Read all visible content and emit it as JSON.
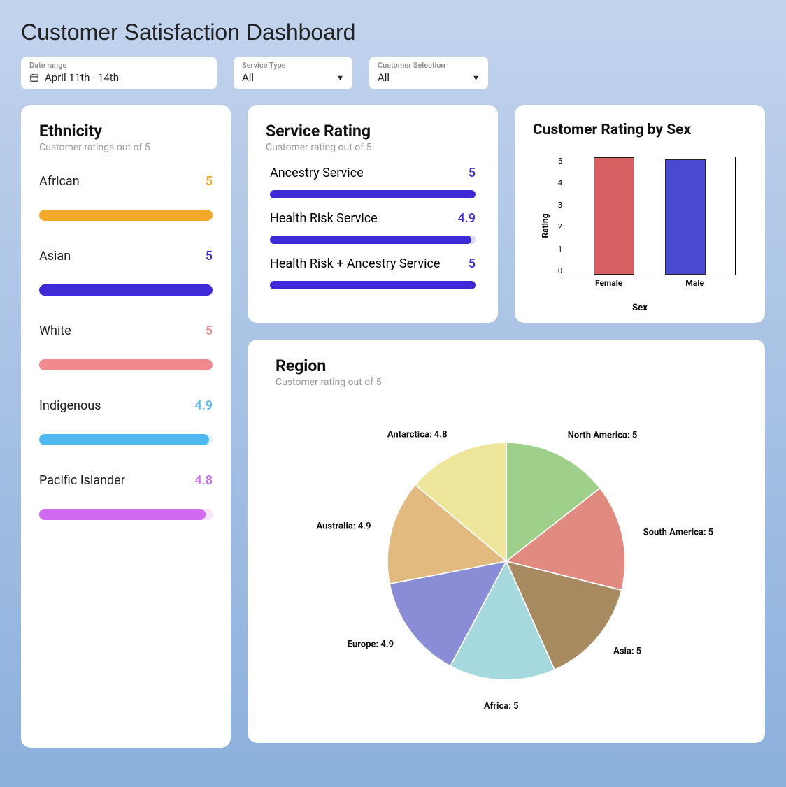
{
  "title": "Customer Satisfaction Dashboard",
  "filters": {
    "date_range": {
      "label": "Date range",
      "value": "April 11th - 14th"
    },
    "service_type": {
      "label": "Service Type",
      "value": "All"
    },
    "customer_selection": {
      "label": "Customer Selection",
      "value": "All"
    }
  },
  "ethnicity": {
    "title": "Ethnicity",
    "subtitle": "Customer ratings out of 5",
    "max": 5,
    "items": [
      {
        "name": "African",
        "value": 5,
        "color": "#f2a92b",
        "value_color": "#f2a92b"
      },
      {
        "name": "Asian",
        "value": 5,
        "color": "#3e2ad6",
        "value_color": "#3e2ad6"
      },
      {
        "name": "White",
        "value": 5,
        "color": "#f08a8f",
        "value_color": "#f08a8f"
      },
      {
        "name": "Indigenous",
        "value": 4.9,
        "color": "#4fb9ef",
        "value_color": "#4fb9ef"
      },
      {
        "name": "Pacific Islander",
        "value": 4.8,
        "color": "#d06af0",
        "value_color": "#d06af0"
      }
    ]
  },
  "service_rating": {
    "title": "Service Rating",
    "subtitle": "Customer rating out of 5",
    "max": 5,
    "items": [
      {
        "name": "Ancestry Service",
        "value": 5
      },
      {
        "name": "Health Risk Service",
        "value": 4.9
      },
      {
        "name": "Health Risk + Ancestry Service",
        "value": 5
      }
    ]
  },
  "sex_rating": {
    "title": "Customer Rating by Sex",
    "ylabel": "Rating",
    "xlabel": "Sex"
  },
  "region": {
    "title": "Region",
    "subtitle": "Customer rating out of 5"
  },
  "chart_data": [
    {
      "id": "ethnicity",
      "type": "bar",
      "title": "Ethnicity — Customer ratings out of 5",
      "categories": [
        "African",
        "Asian",
        "White",
        "Indigenous",
        "Pacific Islander"
      ],
      "values": [
        5,
        5,
        5,
        4.9,
        4.8
      ],
      "ylim": [
        0,
        5
      ]
    },
    {
      "id": "service_rating",
      "type": "bar",
      "title": "Service Rating — Customer rating out of 5",
      "categories": [
        "Ancestry Service",
        "Health Risk Service",
        "Health Risk + Ancestry Service"
      ],
      "values": [
        5,
        4.9,
        5
      ],
      "ylim": [
        0,
        5
      ]
    },
    {
      "id": "customer_rating_by_sex",
      "type": "bar",
      "title": "Customer Rating by Sex",
      "xlabel": "Sex",
      "ylabel": "Rating",
      "categories": [
        "Female",
        "Male"
      ],
      "values": [
        5,
        4.9
      ],
      "colors": [
        "#d66062",
        "#4a4ad1"
      ],
      "ylim": [
        0,
        5
      ],
      "yticks": [
        0,
        1,
        2,
        3,
        4,
        5
      ]
    },
    {
      "id": "region",
      "type": "pie",
      "title": "Region — Customer rating out of 5",
      "slices": [
        {
          "label": "North America",
          "value": 5,
          "color": "#9ed08b"
        },
        {
          "label": "South America",
          "value": 5,
          "color": "#e18a80"
        },
        {
          "label": "Asia",
          "value": 5,
          "color": "#a78a5f"
        },
        {
          "label": "Africa",
          "value": 5,
          "color": "#a6d9de"
        },
        {
          "label": "Europe",
          "value": 4.9,
          "color": "#8a8cd6"
        },
        {
          "label": "Australia",
          "value": 4.9,
          "color": "#e2b97f"
        },
        {
          "label": "Antarctica",
          "value": 4.8,
          "color": "#eee69a"
        }
      ]
    }
  ]
}
